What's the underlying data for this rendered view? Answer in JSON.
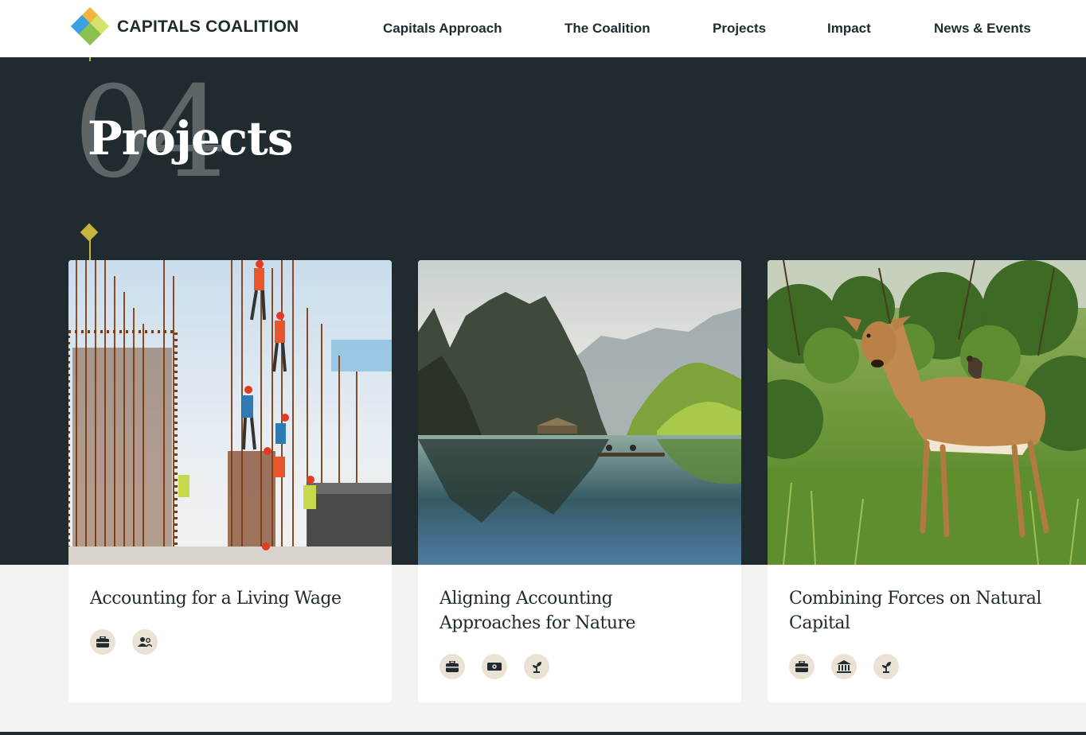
{
  "header": {
    "logo_text": "CAPITALS COALITION",
    "nav": [
      {
        "label": "Capitals Approach"
      },
      {
        "label": "The Coalition"
      },
      {
        "label": "Projects"
      },
      {
        "label": "Impact"
      },
      {
        "label": "News & Events"
      }
    ]
  },
  "hero": {
    "section_number": "04",
    "title": "Projects"
  },
  "cards": [
    {
      "title": "Accounting for a Living Wage",
      "image": "construction-workers-scaffolding",
      "tags": [
        "briefcase-icon",
        "people-icon"
      ]
    },
    {
      "title": "Aligning Accounting Approaches for Nature",
      "image": "karst-mountains-lake-boat",
      "tags": [
        "briefcase-icon",
        "money-icon",
        "plant-icon"
      ]
    },
    {
      "title": "Combining Forces on Natural Capital",
      "image": "impala-with-bird",
      "tags": [
        "briefcase-icon",
        "bank-icon",
        "plant-icon"
      ]
    }
  ],
  "colors": {
    "dark": "#1f2b2e",
    "accent": "#c9b43b",
    "tag_bg": "#ebe2d6",
    "page_bg": "#f4f3f1"
  }
}
